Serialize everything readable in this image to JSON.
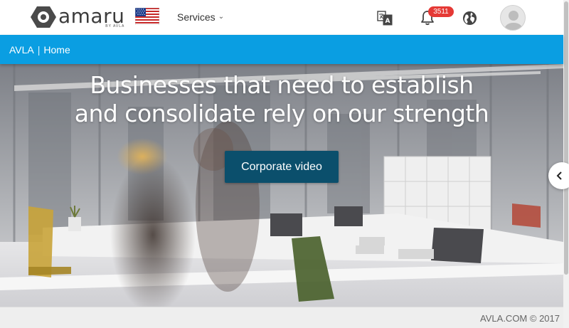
{
  "header": {
    "logo_text": "amaru",
    "logo_sub": "BY AVLA",
    "services_label": "Services",
    "notification_count": "3511",
    "colors": {
      "badge": "#e53935",
      "brand_bar": "#0a9ee2",
      "cta": "#0b4f6c"
    }
  },
  "breadcrumb": {
    "root": "AVLA",
    "separator": "|",
    "current": "Home"
  },
  "hero": {
    "title": "Businesses that need to establish and consolidate rely on our strength",
    "cta_label": "Corporate video"
  },
  "footer": {
    "copyright": "AVLA.COM © 2017"
  },
  "icons": {
    "flag": "us-flag-icon",
    "translate": "translate-icon",
    "notifications": "bell-icon",
    "language": "globe-icon",
    "carousel_prev": "chevron-left-icon"
  }
}
